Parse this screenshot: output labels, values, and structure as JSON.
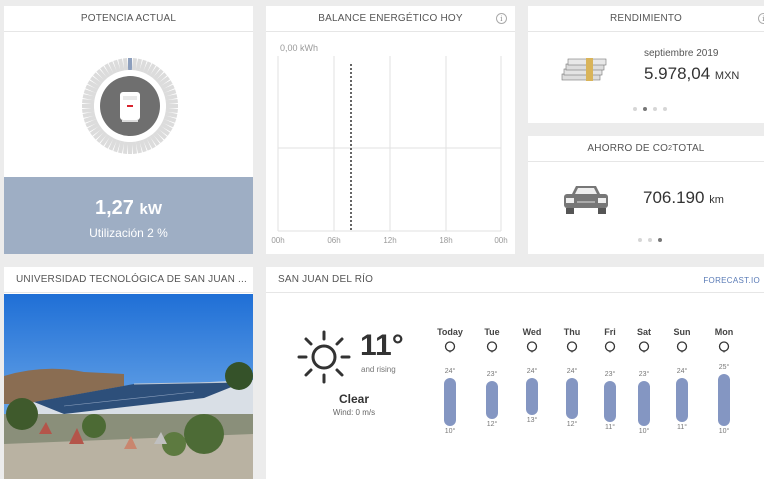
{
  "potencia": {
    "title": "POTENCIA ACTUAL",
    "value": "1,27",
    "unit": "kW",
    "utilization": "Utilización 2 %",
    "utilization_percent": 2
  },
  "balance": {
    "title": "BALANCE ENERGÉTICO HOY",
    "kwh_label": "0,00 kWh",
    "x_ticks": [
      "00h",
      "06h",
      "12h",
      "18h",
      "00h"
    ]
  },
  "rendimiento": {
    "title": "RENDIMIENTO",
    "month": "septiembre 2019",
    "value": "5.978,04",
    "currency": "MXN",
    "dots": 4,
    "active_dot": 1
  },
  "ahorro": {
    "title_prefix": "AHORRO DE CO",
    "title_sub": "2",
    "title_suffix": " TOTAL",
    "value": "706.190",
    "unit": "km",
    "dots": 3,
    "active_dot": 2
  },
  "universidad": {
    "title": "UNIVERSIDAD TECNOLÓGICA DE SAN JUAN ..."
  },
  "weather": {
    "title": "SAN JUAN DEL RÍO",
    "forecast_link": "FORECAST.IO",
    "current_temp": "11°",
    "trend": "and rising",
    "condition": "Clear",
    "wind": "Wind: 0 m/s",
    "days": [
      {
        "name": "Today",
        "hi": "24°",
        "lo": "10°"
      },
      {
        "name": "Tue",
        "hi": "23°",
        "lo": "12°"
      },
      {
        "name": "Wed",
        "hi": "24°",
        "lo": "13°"
      },
      {
        "name": "Thu",
        "hi": "24°",
        "lo": "12°"
      },
      {
        "name": "Fri",
        "hi": "23°",
        "lo": "11°"
      },
      {
        "name": "Sat",
        "hi": "23°",
        "lo": "10°"
      },
      {
        "name": "Sun",
        "hi": "24°",
        "lo": "11°"
      },
      {
        "name": "Mon",
        "hi": "25°",
        "lo": "10°"
      }
    ]
  },
  "colors": {
    "accent": "#9eaec4",
    "bar": "#8496c2",
    "link": "#5a7bb6"
  }
}
